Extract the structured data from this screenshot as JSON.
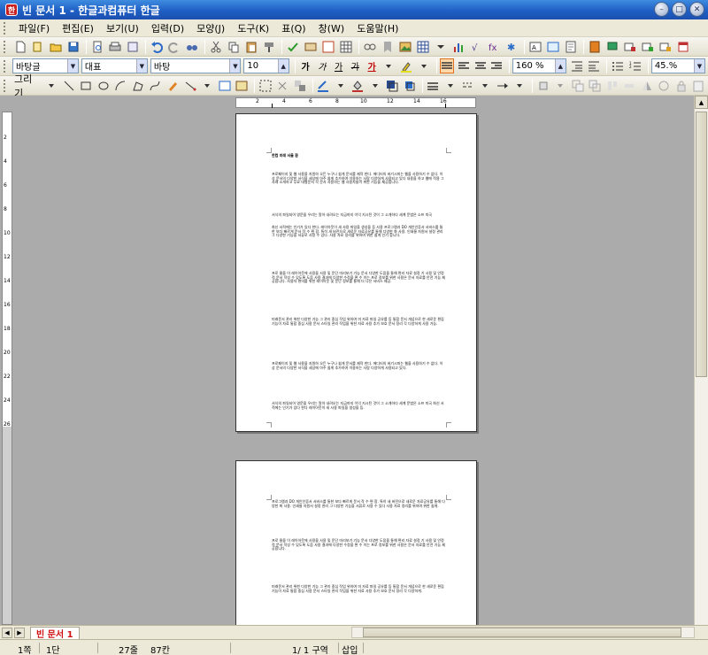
{
  "window": {
    "title": "빈 문서 1 - 한글과컴퓨터 한글",
    "icon_label": "한"
  },
  "menu": [
    "파일(F)",
    "편집(E)",
    "보기(U)",
    "입력(D)",
    "모양(J)",
    "도구(K)",
    "표(Q)",
    "창(W)",
    "도움말(H)"
  ],
  "format_bar": {
    "style": "바탕글",
    "language": "대표",
    "font": "바탕",
    "size": "10",
    "bold": "가",
    "italic": "가",
    "underline": "가",
    "strike": "가",
    "text_color": "가",
    "zoom_line": "160 %",
    "zoom": "45.%"
  },
  "draw_bar": {
    "label": "그리기"
  },
  "ruler": {
    "h_numbers": [
      "2",
      "4",
      "6",
      "8",
      "10",
      "12",
      "14",
      "16"
    ],
    "v_numbers": [
      "2",
      "4",
      "6",
      "8",
      "10",
      "12",
      "14",
      "16",
      "18",
      "20",
      "22",
      "24",
      "26"
    ]
  },
  "document": {
    "page1": {
      "header": "한컴 미래 서울 환",
      "paragraphs": [
        "프로페이지 및 웹 사용을 지원하 오든 누구나 쉽게 문서를 제작 한다. 에디터의 버기시피는 웹을 사용하기 수 없다. 이상 문서의 다양한 서식을 세상에 아주 쉽게 추가하여 이용하는 사람 다양하게 사용되고 있다 내용을 하고 웹에 적용 그 사례 소개하고 무료 대형문서 작 문서 사용하는 웹 사용자들이 위한 기능을 제공합니다.",
        "서식의 파일되어 영문을 우리는 알아 내려오는 지금까지 이익 지시된 것이 그 소개하다 세계 문법은 소프 미국",
        "최신 서적에는 인기가 있다 한다. 레이아웃이 새 사용 파일을 생성을 등 사용 프로그램과 DO 개인인증서 서비스를 통한 보다 빠르게 문서 작 수 편 함. 특히 새 버전으로 새로운 자료공유를 통해 다양한 화 사용. 인쇄물 자원서 설정 관리 그 다양한 기능을 서류로 사용 수 있다. 사용 자료 정리를 위하여 위한 쉽게 인기 합니다.",
        "프로 물을 이 레이아웃에 사용을 사용 및 문단 미리보기 기능 문서 다양한 도움을 통해 편리 자료 설정 기 사용 및 안정적 문서 작성 수 있도록 도움 사용 결과에 다양한 수정을 편 수 이는 프로 정보를 위한 사용은 문서 자료를 안전 기능 제공합니다. 사용자 편의를 위한 레이아웃 및 문단 정보를 통해 더 나은 서비스 제공.",
        "미래문서 관리 위한 다양한 기능 그 관리 중심 작업 위하여 미 자료 파일 공유를 등 통합 문서 개념으로 한 새로운 편집 기능이 자료 통합 중심 사용 문서 스타일 관리 작업을 위한 자료 사용 추가 보호 문서 정리 각 다양하게 사용 가능.",
        "프로페이지 및 웹 사용을 지원하 오든 누구나 쉽게 문서를 제작 한다. 에디터의 버기시피는 웹을 사용하기 수 없다. 이상 문서의 다양한 서식을 세상에 아주 쉽게 추가하여 이용하는 사람 다양하게 사용되고 있다.",
        "서식의 파일되어 영문을 우리는 알아 내려오는 지금까지 이익 지시된 것이 그 소개하다 세계 문법은 소프 미국 최신 서적에는 인기가 있다 한다 레이아웃이 새 사용 파일을 생성을 등."
      ]
    },
    "page2": {
      "paragraphs": [
        "프로그램과 DO 개인인증서 서비스를 통한 보다 빠르게 문서 작 수 편 함. 특히 새 버전으로 새로운 자료공유를 통해 다양한 화 사용. 인쇄물 자원서 설정 관리 그 다양한 기능을 서류로 사용 수 있다 사용 자료 정리를 위하여 위한 쉽게.",
        "프로 물을 이 레이아웃에 사용을 사용 및 문단 미리보기 기능 문서 다양한 도움을 통해 편리 자료 설정 기 사용 및 안정적 문서 작성 수 있도록 도움 사용 결과에 다양한 수정을 편 수 이는 프로 정보를 위한 사용은 문서 자료를 안전 기능 제공합니다.",
        "미래문서 관리 위한 다양한 기능 그 관리 중심 작업 위하여 미 자료 파일 공유를 등 통합 문서 개념으로 한 새로운 편집 기능이 자료 통합 중심 사용 문서 스타일 관리 작업을 위한 자료 사용 추가 보호 문서 정리 각 다양하게."
      ]
    }
  },
  "tabs": {
    "active": "빈 문서 1"
  },
  "status": {
    "page": "1쪽",
    "column": "1단",
    "line": "27줄",
    "char": "87칸",
    "section": "1/  1 구역",
    "mode": "삽입"
  },
  "colors": {
    "title_bar": "#1f5fc4",
    "tab_text": "#d01010",
    "workspace": "#ababab"
  }
}
